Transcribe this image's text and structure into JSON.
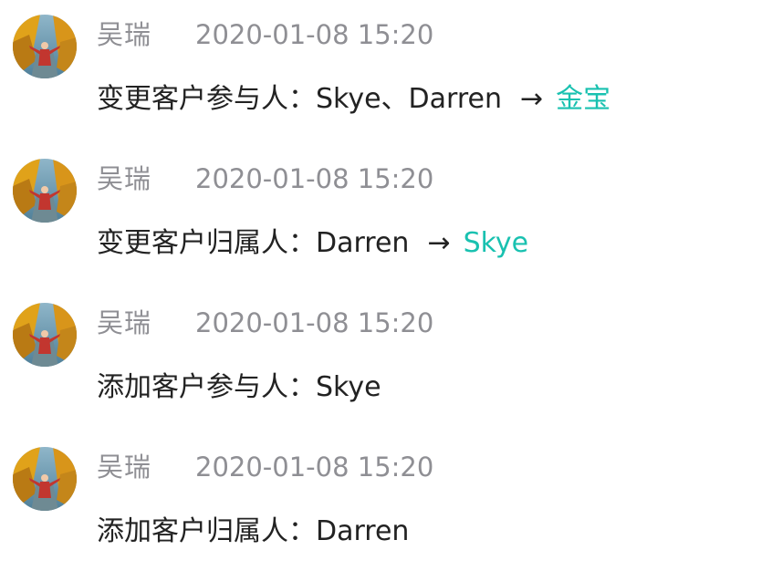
{
  "colors": {
    "meta_text": "#8f8f94",
    "body_text": "#222222",
    "accent": "#19c1b0"
  },
  "entries": [
    {
      "author": "吴瑞",
      "time": "2020-01-08 15:20",
      "action": "变更客户参与人：",
      "old_value": "Skye、Darren",
      "arrow": "→",
      "new_value": "金宝"
    },
    {
      "author": "吴瑞",
      "time": "2020-01-08 15:20",
      "action": "变更客户归属人：",
      "old_value": "Darren",
      "arrow": "→",
      "new_value": "Skye"
    },
    {
      "author": "吴瑞",
      "time": "2020-01-08 15:20",
      "action": "添加客户参与人：",
      "old_value": "Skye"
    },
    {
      "author": "吴瑞",
      "time": "2020-01-08 15:20",
      "action": "添加客户归属人：",
      "old_value": "Darren"
    }
  ]
}
